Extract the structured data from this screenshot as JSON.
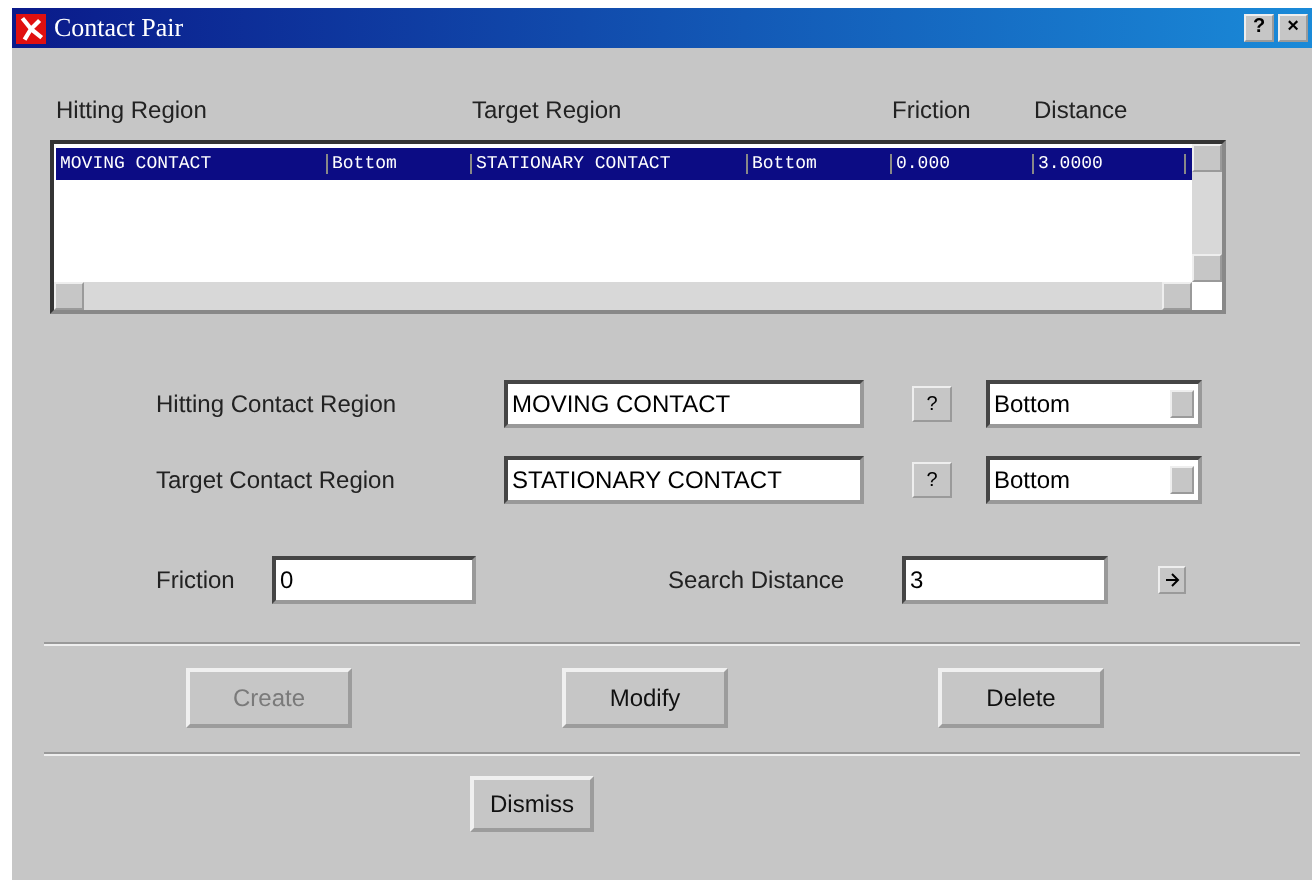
{
  "window": {
    "title": "Contact Pair",
    "title_buttons": [
      "?",
      "×"
    ]
  },
  "table": {
    "columns": [
      "Hitting Region",
      "",
      "Target Region",
      "",
      "Friction",
      "Distance"
    ],
    "rows": [
      {
        "cells": [
          "MOVING CONTACT",
          "Bottom",
          "STATIONARY CONTACT",
          "Bottom",
          "0.000",
          "3.0000"
        ],
        "selected": true
      }
    ]
  },
  "region_fields": [
    {
      "label": "Hitting Contact Region",
      "value": "MOVING CONTACT",
      "help": "?",
      "side": "Bottom"
    },
    {
      "label": "Target Contact Region",
      "value": "STATIONARY CONTACT",
      "help": "?",
      "side": "Bottom"
    }
  ],
  "friction": {
    "label": "Friction",
    "value": "0"
  },
  "search_distance": {
    "label": "Search Distance",
    "value": "3"
  },
  "actions": [
    {
      "label": "Create",
      "disabled": true
    },
    {
      "label": "Modify",
      "disabled": false
    },
    {
      "label": "Delete",
      "disabled": false
    }
  ],
  "dismiss": {
    "label": "Dismiss"
  }
}
